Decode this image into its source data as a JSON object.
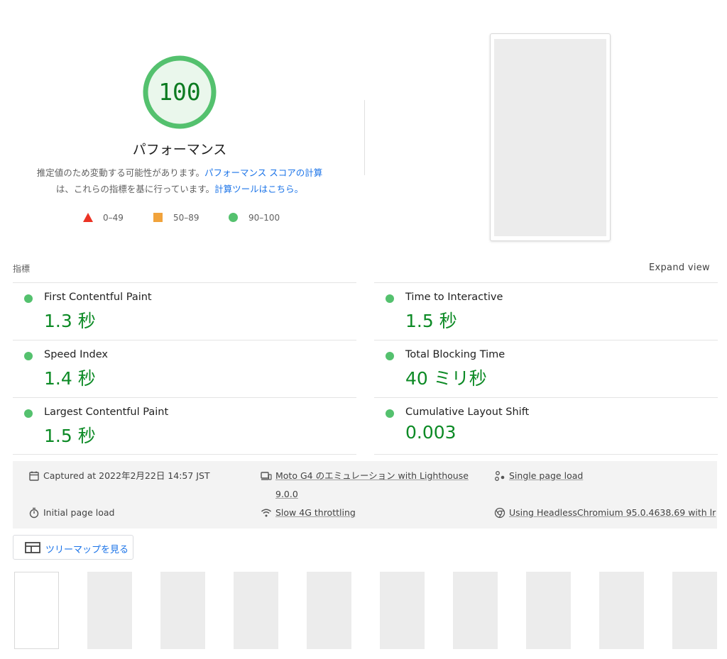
{
  "summary": {
    "score": "100",
    "category_title": "パフォーマンス",
    "desc_line1_text": "推定値のため変動する可能性があります。",
    "desc_line1_link": "パフォーマンス スコアの計算",
    "desc_line2_text": "は、これらの指標を基に行っています。",
    "desc_line2_link": "計算ツールはこちら。",
    "colors": {
      "pass": "#54c16e",
      "pass_text": "#0c8a25",
      "average": "#f1a33c",
      "fail": "#eb3324",
      "link": "#1a73e8"
    }
  },
  "legend": [
    {
      "label": "0–49",
      "shape": "triangle"
    },
    {
      "label": "50–89",
      "shape": "square"
    },
    {
      "label": "90–100",
      "shape": "circle"
    }
  ],
  "metrics": {
    "header": "指標",
    "expand_label": "Expand view",
    "items": [
      {
        "name": "First Contentful Paint",
        "value": "1.3 秒"
      },
      {
        "name": "Time to Interactive",
        "value": "1.5 秒"
      },
      {
        "name": "Speed Index",
        "value": "1.4 秒"
      },
      {
        "name": "Total Blocking Time",
        "value": "40 ミリ秒"
      },
      {
        "name": "Largest Contentful Paint",
        "value": "1.5 秒"
      },
      {
        "name": "Cumulative Layout Shift",
        "value": "0.003"
      }
    ]
  },
  "runinfo": {
    "captured": "Captured at 2022年2月22日 14:57 JST",
    "device_line1": "Moto G4 のエミュレーション with Lighthouse",
    "device_line2": "9.0.0",
    "load_type": "Single page load",
    "initial": "Initial page load",
    "throttling": "Slow 4G throttling",
    "browser": "Using HeadlessChromium 95.0.4638.69 with lr"
  },
  "treemap": {
    "label": "ツリーマップを見る",
    "icon": "treemap-icon"
  }
}
